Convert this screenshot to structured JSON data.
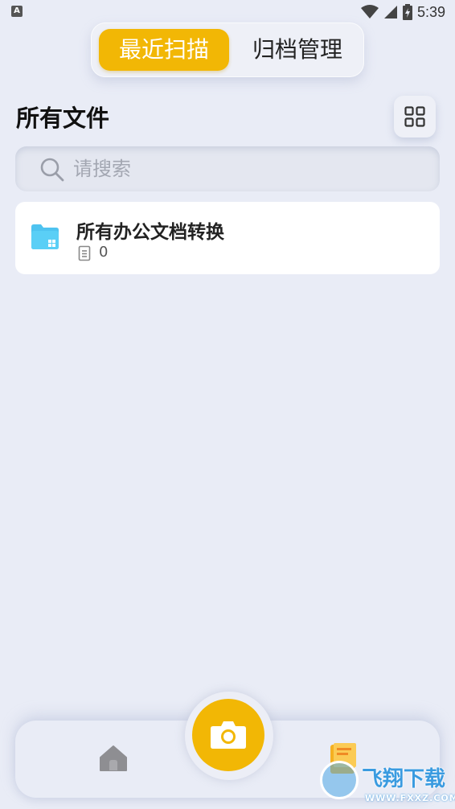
{
  "status_bar": {
    "app_indicator": "A",
    "time": "5:39",
    "icons": [
      "wifi-icon",
      "signal-icon",
      "battery-icon"
    ]
  },
  "tabs": [
    {
      "label": "最近扫描",
      "active": true
    },
    {
      "label": "归档管理",
      "active": false
    }
  ],
  "section": {
    "title": "所有文件",
    "view_toggle_icon": "grid-view-icon"
  },
  "search": {
    "placeholder": "请搜索",
    "value": ""
  },
  "files": [
    {
      "name": "所有办公文档转换",
      "count": "0",
      "icon": "folder-icon"
    }
  ],
  "bottom_nav": {
    "left_icon": "home-icon",
    "center_icon": "camera-icon",
    "right_icon": "document-folder-icon"
  },
  "watermark": {
    "text": "飞翔下载",
    "url": "WWW.FXXZ.COM"
  },
  "colors": {
    "background": "#E9ECF6",
    "accent": "#F2B705",
    "card": "#FFFFFF"
  }
}
